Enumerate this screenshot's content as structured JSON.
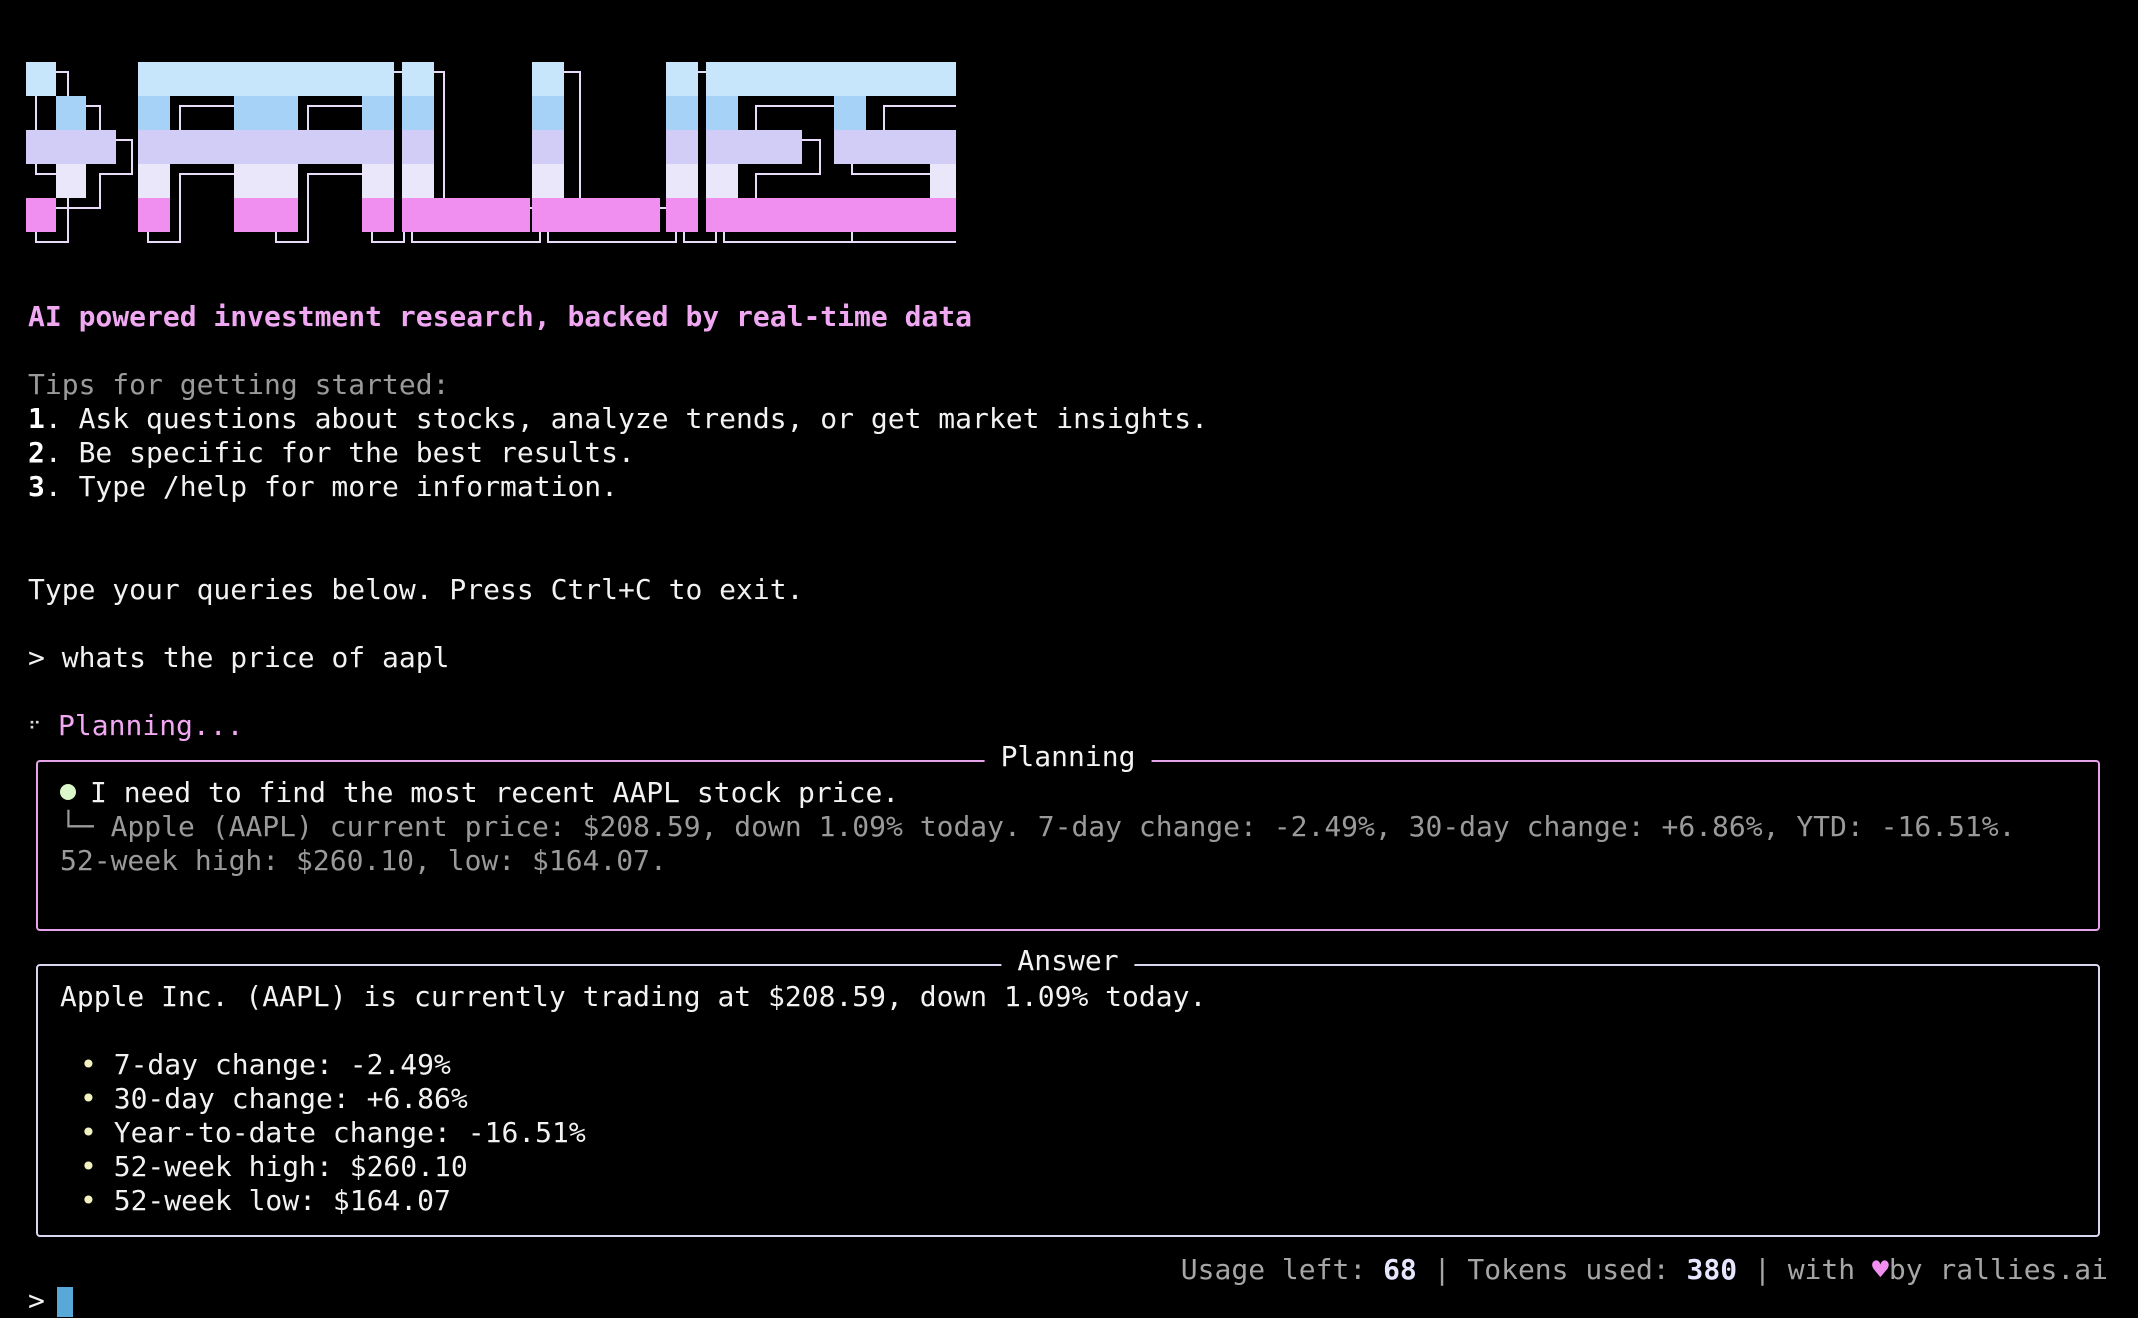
{
  "logo": {
    "text": ">RALLIES",
    "colors": [
      "#c8e6fb",
      "#a6d2f7",
      "#d2cdf6",
      "#ebe7fb",
      "#f08ff0"
    ]
  },
  "tagline": "AI powered investment research, backed by real-time data",
  "tips": {
    "heading": "Tips for getting started:",
    "items": [
      {
        "num": "1",
        "text": ". Ask questions about stocks, analyze trends, or get market insights."
      },
      {
        "num": "2",
        "text": ". Be specific for the best results."
      },
      {
        "num": "3",
        "text": ". Type /help for more information."
      }
    ]
  },
  "instructions": "Type your queries below. Press Ctrl+C to exit.",
  "query": {
    "prompt": ">",
    "text": "whats the price of aapl"
  },
  "status_line": {
    "spinner": "⠋",
    "text": "Planning..."
  },
  "planning": {
    "title": "Planning",
    "step": "I need to find the most recent AAPL stock price.",
    "result_branch": "└─",
    "result": "Apple (AAPL) current price: $208.59, down 1.09% today. 7-day change: -2.49%, 30-day change: +6.86%, YTD: -16.51%. 52-week high: $260.10, low: $164.07."
  },
  "answer": {
    "title": "Answer",
    "summary": "Apple Inc. (AAPL) is currently trading at $208.59, down 1.09% today.",
    "bullet": "•",
    "items": [
      "7-day change: -2.49%",
      "30-day change: +6.86%",
      "Year-to-date change: -16.51%",
      "52-week high: $260.10",
      "52-week low: $164.07"
    ]
  },
  "footer": {
    "usage_label": "Usage left: ",
    "usage_value": "68",
    "sep": " | ",
    "tokens_label": "Tokens used: ",
    "tokens_value": "380",
    "with_label": "with ",
    "heart": "♥",
    "by_label": "by rallies.ai"
  },
  "input": {
    "prompt": ">"
  }
}
